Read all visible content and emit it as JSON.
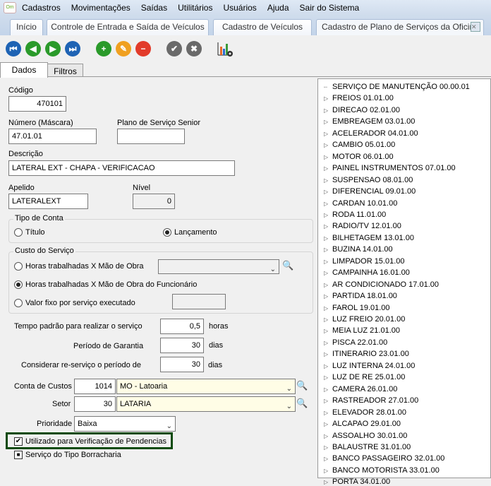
{
  "menu": [
    "Cadastros",
    "Movimentações",
    "Saídas",
    "Utilitários",
    "Usuários",
    "Ajuda",
    "Sair do Sistema"
  ],
  "tabs": [
    "Início",
    "Controle de Entrada e Saída de Veículos",
    "Cadastro de Veículos",
    "Cadastro de Plano de Serviços da Oficina"
  ],
  "toolbar": {
    "icons": [
      "first-icon",
      "previous-icon",
      "next-icon",
      "last-icon",
      "add-icon",
      "edit-icon",
      "delete-icon",
      "confirm-icon",
      "cancel-icon",
      "chart-settings-icon"
    ]
  },
  "form_tabs": [
    "Dados",
    "Filtros"
  ],
  "form": {
    "codigo_label": "Código",
    "codigo": "470101",
    "numero_label": "Número (Máscara)",
    "numero": "47.01.01",
    "plano_label": "Plano de Serviço Senior",
    "plano": "",
    "descricao_label": "Descrição",
    "descricao": "LATERAL EXT - CHAPA - VERIFICACAO",
    "apelido_label": "Apelido",
    "apelido": "LATERALEXT",
    "nivel_label": "Nível",
    "nivel": "0",
    "tipo_conta": {
      "title": "Tipo de Conta",
      "options": [
        "Título",
        "Lançamento"
      ],
      "selected": "Lançamento"
    },
    "custo": {
      "title": "Custo do Serviço",
      "options": [
        "Horas trabalhadas X Mão de Obra",
        "Horas trabalhadas X Mão de Obra do Funcionário",
        "Valor fixo por serviço executado"
      ],
      "selected": "Horas trabalhadas X Mão de Obra do Funcionário"
    },
    "tempo_label": "Tempo padrão para realizar o serviço",
    "tempo": "0,5",
    "tempo_unit": "horas",
    "garantia_label": "Período de Garantia",
    "garantia": "30",
    "garantia_unit": "dias",
    "reservico_label": "Considerar re-serviço o período de",
    "reservico": "30",
    "reservico_unit": "dias",
    "conta_label": "Conta de Custos",
    "conta_code": "1014",
    "conta_name": "MO - Latoaria",
    "setor_label": "Setor",
    "setor_code": "30",
    "setor_name": "LATARIA",
    "prioridade_label": "Prioridade",
    "prioridade": "Baixa",
    "verif_label": "Utilizado para Verificação de Pendencias",
    "verif_checked": true,
    "borracharia_label": "Serviço do Tipo Borracharia",
    "borracharia_state": "indeterminate"
  },
  "tree": [
    "SERVIÇO DE MANUTENÇÃO 00.00.01",
    "FREIOS 01.01.00",
    "DIRECAO 02.01.00",
    "EMBREAGEM 03.01.00",
    "ACELERADOR 04.01.00",
    "CAMBIO 05.01.00",
    "MOTOR 06.01.00",
    "PAINEL INSTRUMENTOS 07.01.00",
    "SUSPENSAO 08.01.00",
    "DIFERENCIAL 09.01.00",
    "CARDAN 10.01.00",
    "RODA 11.01.00",
    "RADIO/TV 12.01.00",
    "BILHETAGEM 13.01.00",
    "BUZINA 14.01.00",
    "LIMPADOR 15.01.00",
    "CAMPAINHA 16.01.00",
    "AR CONDICIONADO 17.01.00",
    "PARTIDA 18.01.00",
    "FAROL 19.01.00",
    "LUZ FREIO 20.01.00",
    "MEIA LUZ 21.01.00",
    "PISCA 22.01.00",
    "ITINERARIO 23.01.00",
    "LUZ INTERNA 24.01.00",
    "LUZ DE RE 25.01.00",
    "CAMERA 26.01.00",
    "RASTREADOR 27.01.00",
    "ELEVADOR 28.01.00",
    "ALCAPAO 29.01.00",
    "ASSOALHO 30.01.00",
    "BALAUSTRE 31.01.00",
    "BANCO PASSAGEIRO 32.01.00",
    "BANCO MOTORISTA 33.01.00",
    "PORTA 34.01.00"
  ],
  "colors": {
    "highlight_border": "#0b4a0b",
    "toolbar_blue": "#1e63b4",
    "toolbar_green": "#2a9a2a"
  }
}
